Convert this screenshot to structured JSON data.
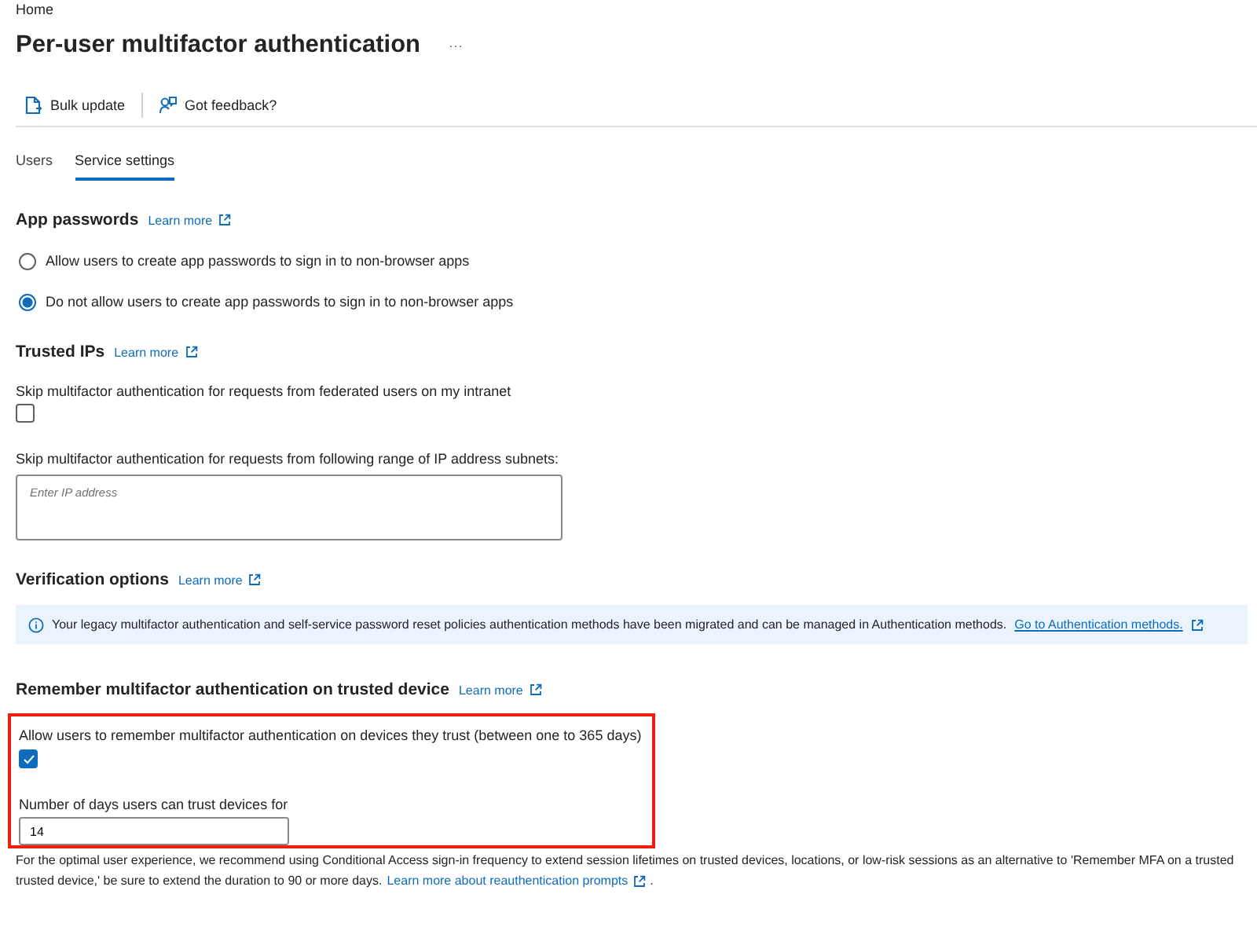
{
  "breadcrumb": "Home",
  "title": "Per-user multifactor authentication",
  "more": "···",
  "toolbar": [
    {
      "label": "Bulk update",
      "kind": "bulk"
    },
    {
      "label": "Got feedback?",
      "kind": "feedback"
    }
  ],
  "tabs": [
    {
      "label": "Users",
      "selected": false
    },
    {
      "label": "Service settings",
      "selected": true
    }
  ],
  "app_passwords": {
    "heading": "App passwords",
    "learn_more": "Learn more",
    "options": [
      {
        "label": "Allow users to create app passwords to sign in to non-browser apps",
        "selected": false
      },
      {
        "label": "Do not allow users to create app passwords to sign in to non-browser apps",
        "selected": true
      }
    ]
  },
  "trusted_ips": {
    "heading": "Trusted IPs",
    "learn_more": "Learn more",
    "federated": {
      "label": "Skip multifactor authentication for requests from federated users on my intranet",
      "checked": false
    },
    "subnets": {
      "label": "Skip multifactor authentication for requests from following range of IP address subnets:",
      "placeholder": "Enter IP address"
    }
  },
  "verification": {
    "heading": "Verification options",
    "learn_more": "Learn more",
    "banner": {
      "text": "Your legacy multifactor authentication and self-service password reset policies authentication methods have been migrated and can be managed in Authentication methods.",
      "link": "Go to Authentication methods."
    }
  },
  "remember": {
    "heading": "Remember multifactor authentication on trusted device",
    "learn_more": "Learn more",
    "highlighted": true,
    "allow": {
      "label": "Allow users to remember multifactor authentication on devices they trust (between one to 365 days)",
      "checked": true
    },
    "days": {
      "label": "Number of days users can trust devices for",
      "value": "14"
    }
  },
  "footnote": {
    "line_1": "For the optimal user experience, we recommend using Conditional Access sign-in frequency to extend session lifetimes on trusted devices, locations, or low-risk sessions as an alternative to 'Remember MFA on a trusted",
    "line_2": "trusted device,' be sure to extend the duration to 90 or more days.",
    "link": "Learn more about reauthentication prompts",
    "trail": "."
  }
}
